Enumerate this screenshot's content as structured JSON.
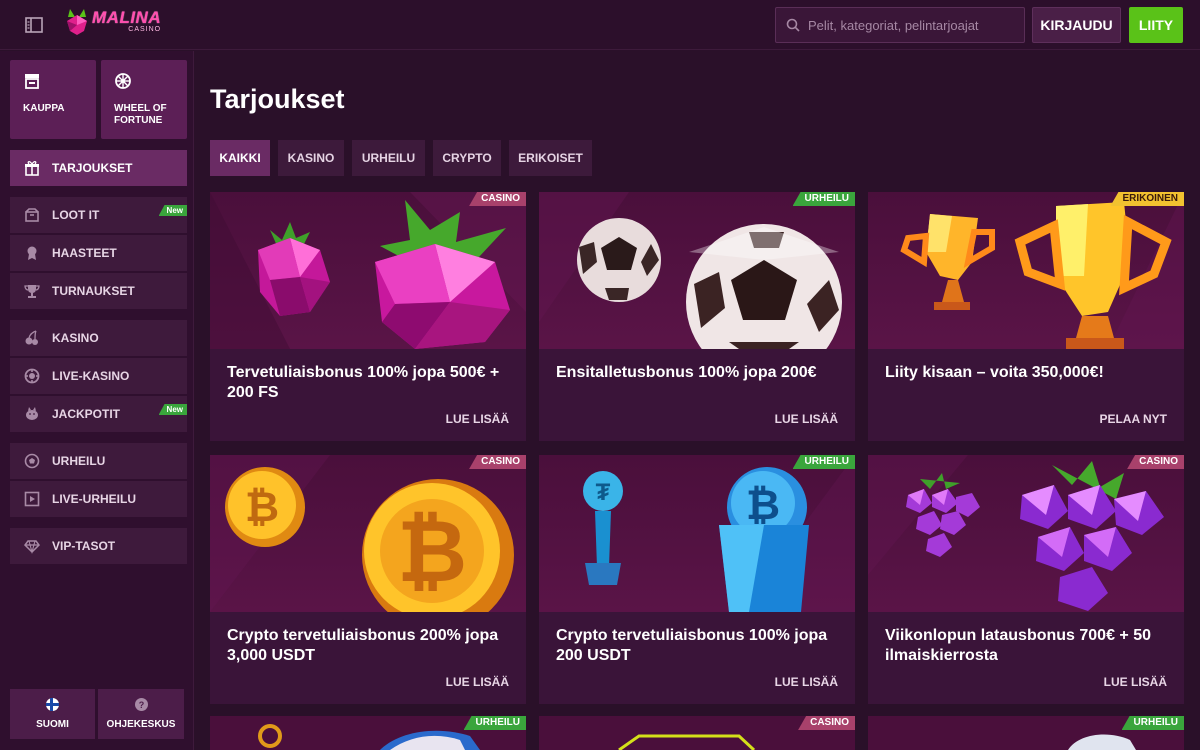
{
  "header": {
    "logo_name": "MALINA",
    "logo_sub": "CASINO",
    "search_placeholder": "Pelit, kategoriat, pelintarjoajat",
    "login_label": "KIRJAUDU",
    "join_label": "LIITY"
  },
  "sidebar": {
    "tiles": [
      {
        "label": "KAUPPA",
        "icon": "shop-icon"
      },
      {
        "label": "WHEEL OF FORTUNE",
        "icon": "wheel-icon"
      }
    ],
    "items": [
      {
        "label": "TARJOUKSET",
        "icon": "gift-icon",
        "active": true
      },
      {
        "label": "LOOT IT",
        "icon": "box-icon",
        "badge": "New"
      },
      {
        "label": "HAASTEET",
        "icon": "medal-icon"
      },
      {
        "label": "TURNAUKSET",
        "icon": "trophy-icon"
      },
      {
        "label": "KASINO",
        "icon": "cherries-icon"
      },
      {
        "label": "LIVE-KASINO",
        "icon": "chip-icon"
      },
      {
        "label": "JACKPOTIT",
        "icon": "piggy-icon",
        "badge": "New"
      },
      {
        "label": "URHEILU",
        "icon": "ball-icon"
      },
      {
        "label": "LIVE-URHEILU",
        "icon": "play-icon"
      },
      {
        "label": "VIP-TASOT",
        "icon": "diamond-icon"
      }
    ],
    "bottom": [
      {
        "label": "SUOMI",
        "icon": "finland-flag-icon"
      },
      {
        "label": "OHJEKESKUS",
        "icon": "help-icon"
      }
    ]
  },
  "main": {
    "title": "Tarjoukset",
    "tabs": [
      "KAIKKI",
      "KASINO",
      "URHEILU",
      "CRYPTO",
      "ERIKOISET"
    ],
    "cards": [
      {
        "badge": "CASINO",
        "title": "Tervetuliaisbonus 100% jopa 500€ + 200 FS",
        "cta": "LUE LISÄÄ",
        "image": "raspberry"
      },
      {
        "badge": "URHEILU",
        "title": "Ensitalletusbonus 100% jopa 200€",
        "cta": "LUE LISÄÄ",
        "image": "football"
      },
      {
        "badge": "ERIKOINEN",
        "title": "Liity kisaan – voita 350,000€!",
        "cta": "PELAA NYT",
        "image": "trophy"
      },
      {
        "badge": "CASINO",
        "title": "Crypto tervetuliaisbonus 200% jopa 3,000 USDT",
        "cta": "LUE LISÄÄ",
        "image": "bitcoin"
      },
      {
        "badge": "URHEILU",
        "title": "Crypto tervetuliaisbonus 100% jopa 200 USDT",
        "cta": "LUE LISÄÄ",
        "image": "crypto-trophy"
      },
      {
        "badge": "CASINO",
        "title": "Viikonlopun latausbonus 700€ + 50 ilmaiskierrosta",
        "cta": "LUE LISÄÄ",
        "image": "grapes"
      }
    ],
    "partial_badges": [
      "URHEILU",
      "CASINO",
      "URHEILU"
    ]
  }
}
